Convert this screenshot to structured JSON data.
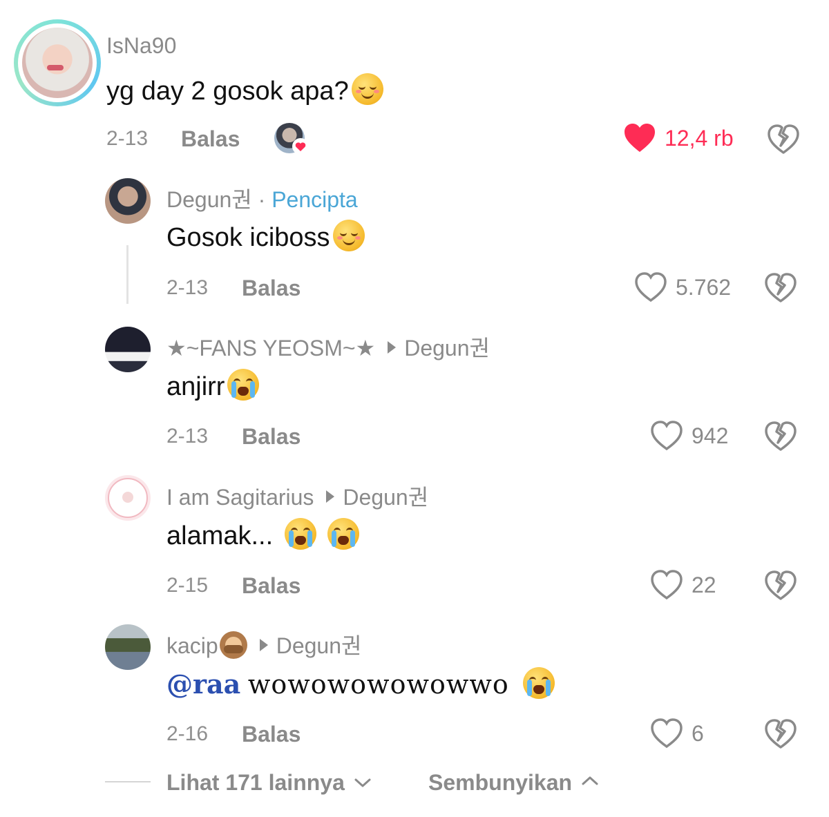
{
  "comments": [
    {
      "username": "IsNa90",
      "text": "yg day 2 gosok apa?",
      "text_emoji": "relieved-face",
      "date": "2-13",
      "reply_label": "Balas",
      "likes": "12,4 rb",
      "liked": true,
      "creator_liked": true
    },
    {
      "username": "Degun권",
      "creator_label": "Pencipta",
      "separator": "·",
      "text": "Gosok iciboss",
      "text_emoji": "smiling-face",
      "date": "2-13",
      "reply_label": "Balas",
      "likes": "5.762"
    },
    {
      "username": "★~FANS YEOSM~★",
      "reply_to": "Degun권",
      "text": "anjirr",
      "text_emoji": "loudly-crying-face",
      "date": "2-13",
      "reply_label": "Balas",
      "likes": "942"
    },
    {
      "username": "I am Sagitarius",
      "reply_to": "Degun권",
      "text": "alamak...",
      "text_emoji": "loudly-crying-face x2",
      "date": "2-15",
      "reply_label": "Balas",
      "likes": "22"
    },
    {
      "username": "kacip",
      "username_emoji": "see-no-evil-monkey",
      "reply_to": "Degun권",
      "mention": "@raa",
      "text": "wowowowowowwo",
      "text_emoji": "loudly-crying-face",
      "date": "2-16",
      "reply_label": "Balas",
      "likes": "6"
    }
  ],
  "footer": {
    "see_more": "Lihat 171 lainnya",
    "hide": "Sembunyikan"
  },
  "colors": {
    "like_active": "#fe2c55",
    "creator_tag": "#4aa6d6",
    "mention": "#2b4fb0",
    "muted": "#8a8a8a"
  }
}
